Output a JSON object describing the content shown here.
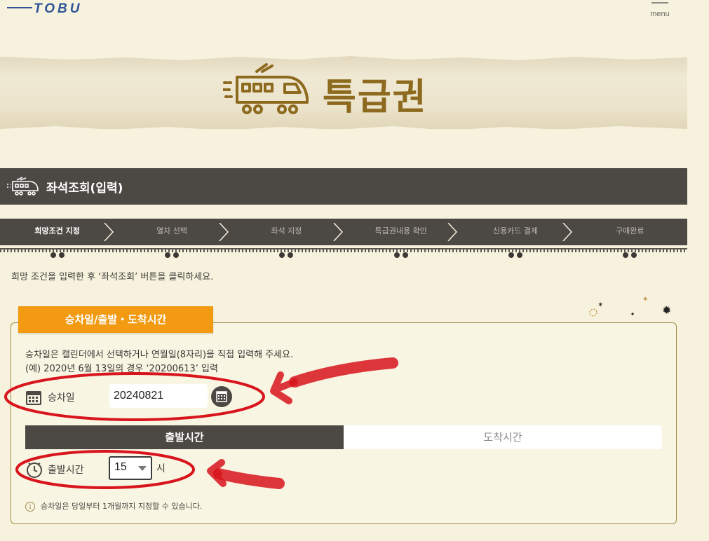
{
  "header": {
    "logo_text": "TOBU",
    "menu_label": "menu"
  },
  "banner": {
    "title": "특급권"
  },
  "section": {
    "title": "좌석조회(입력)"
  },
  "steps": [
    {
      "label": "희망조건 지정",
      "active": true
    },
    {
      "label": "열차 선택",
      "active": false
    },
    {
      "label": "좌석 지정",
      "active": false
    },
    {
      "label": "특급권내용 확인",
      "active": false
    },
    {
      "label": "신용카드 결제",
      "active": false
    },
    {
      "label": "구매완료",
      "active": false
    }
  ],
  "intro": "희망 조건을 입력한 후 ‘좌석조회’ 버튼을 클릭하세요.",
  "form": {
    "tab_label": "승차일/출발・도착시간",
    "desc_line1": "승차일은 캘린더에서 선택하거나 연월일(8자리)을 직접 입력해 주세요.",
    "desc_line2": "(예) 2020년 6월 13일의 경우 ‘20200613’ 입력",
    "date_label": "승차일",
    "date_value": "20240821",
    "time_tabs": {
      "departure": "출발시간",
      "arrival": "도착시간"
    },
    "time_label": "출발시간",
    "hour_value": "15",
    "hour_unit": "시",
    "note": "승차일은 당일부터 1개월까지 지정할 수 있습니다."
  },
  "colors": {
    "accent_orange": "#f19a12",
    "dark_bar": "#4c4844",
    "gold_text": "#8d6a1e",
    "annotation_red": "#d8141c"
  }
}
